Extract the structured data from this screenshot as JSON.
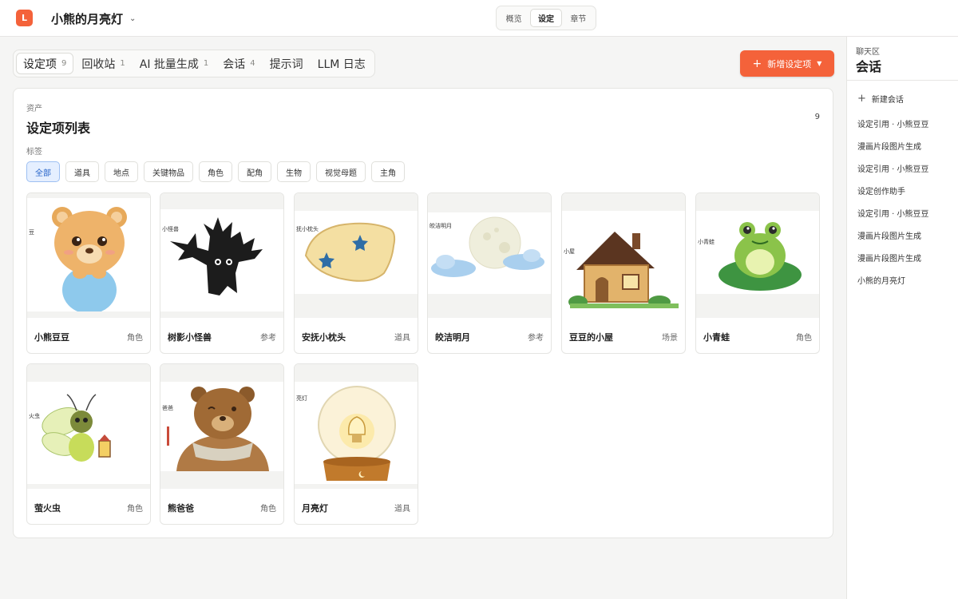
{
  "app": {
    "logo_letter": "L",
    "project_title": "小熊的月亮灯"
  },
  "view_switch": [
    "概览",
    "设定",
    "章节"
  ],
  "tabs": [
    {
      "label": "设定项",
      "count": "9"
    },
    {
      "label": "回收站",
      "count": "1"
    },
    {
      "label": "AI 批量生成",
      "count": "1"
    },
    {
      "label": "会话",
      "count": "4"
    },
    {
      "label": "提示词",
      "count": ""
    },
    {
      "label": "LLM 日志",
      "count": ""
    }
  ],
  "new_button": {
    "label": "新增设定项",
    "color": "#f4623a"
  },
  "panel": {
    "eyebrow": "资产",
    "title": "设定项列表",
    "count": "9",
    "tag_label": "标签",
    "tags": [
      "全部",
      "道具",
      "地点",
      "关键物品",
      "角色",
      "配角",
      "生物",
      "视觉母题",
      "主角"
    ]
  },
  "items": [
    {
      "name": "小熊豆豆",
      "type": "角色",
      "art": "bear",
      "caption": "豆"
    },
    {
      "name": "树影小怪兽",
      "type": "参考",
      "art": "tree",
      "caption": "小怪兽"
    },
    {
      "name": "安抚小枕头",
      "type": "道具",
      "art": "pillow",
      "caption": "抚小枕头"
    },
    {
      "name": "皎洁明月",
      "type": "参考",
      "art": "moon",
      "caption": "皎洁明月"
    },
    {
      "name": "豆豆的小屋",
      "type": "场景",
      "art": "house",
      "caption": "小屋"
    },
    {
      "name": "小青蛙",
      "type": "角色",
      "art": "frog",
      "caption": "小青蛙"
    },
    {
      "name": "萤火虫",
      "type": "角色",
      "art": "firefly",
      "caption": "火虫"
    },
    {
      "name": "熊爸爸",
      "type": "角色",
      "art": "papa",
      "caption": "爸爸"
    },
    {
      "name": "月亮灯",
      "type": "道具",
      "art": "lamp",
      "caption": "亮灯"
    }
  ],
  "sidebar": {
    "eyebrow": "聊天区",
    "title": "会话",
    "new_session": "新建会话",
    "sessions": [
      "设定引用 · 小熊豆豆",
      "漫画片段图片生成",
      "设定引用 · 小熊豆豆",
      "设定创作助手",
      "设定引用 · 小熊豆豆",
      "漫画片段图片生成",
      "漫画片段图片生成",
      "小熊的月亮灯"
    ]
  }
}
